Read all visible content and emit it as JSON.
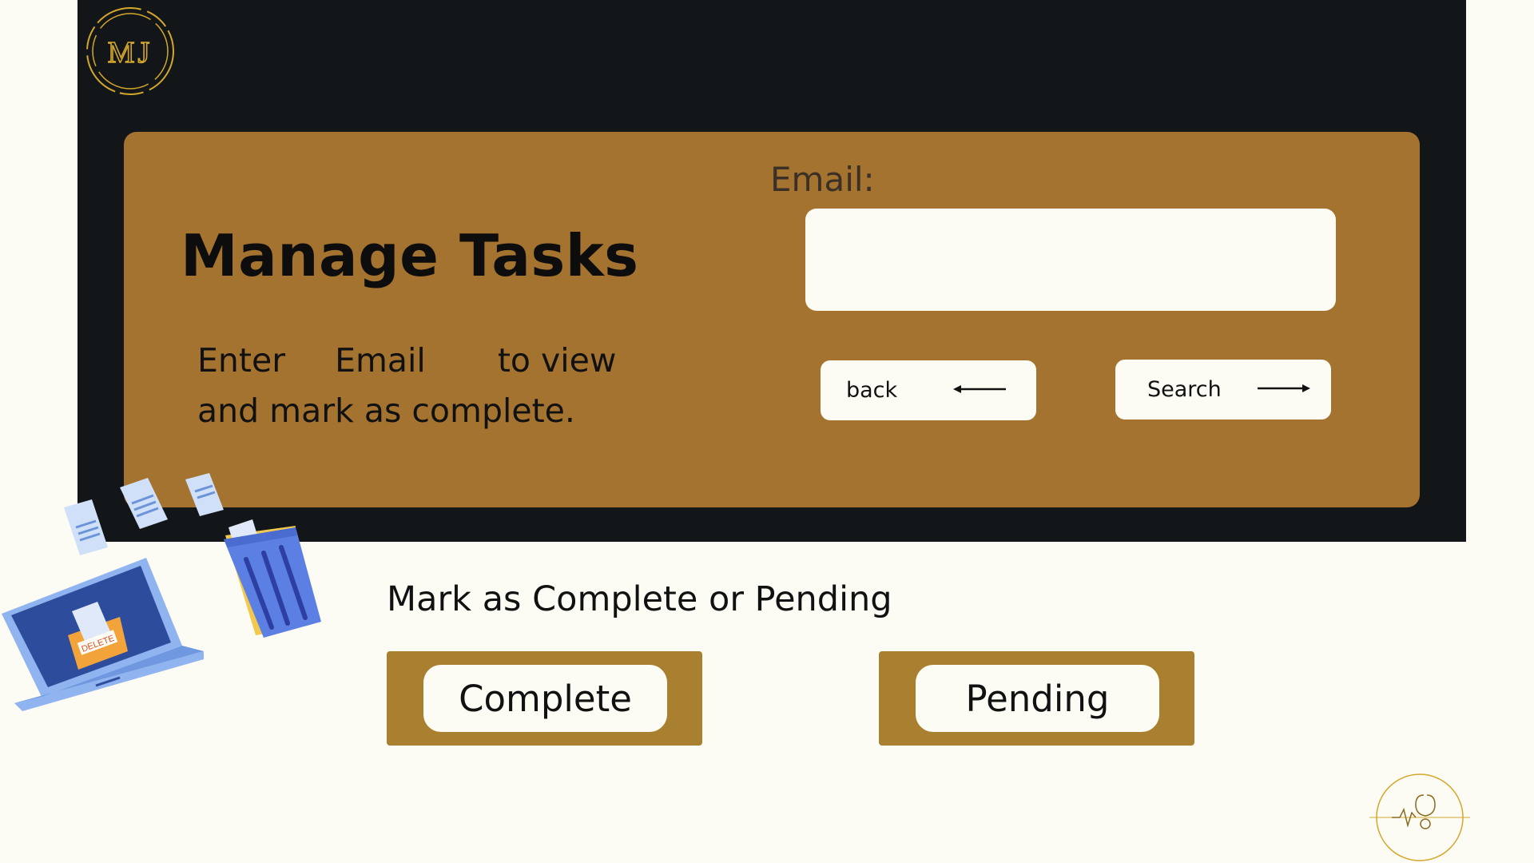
{
  "brand": {
    "logo_text": "MJ"
  },
  "card": {
    "title": "Manage Tasks",
    "description_word1": "Enter",
    "description_word2": "Email",
    "description_word3": "to view",
    "description_line2": "and mark as complete."
  },
  "email": {
    "label": "Email:",
    "value": "",
    "placeholder": ""
  },
  "buttons": {
    "back_label": "back",
    "search_label": "Search"
  },
  "status_section": {
    "heading": "Mark as Complete or Pending",
    "complete_label": "Complete",
    "pending_label": "Pending"
  },
  "illustration": {
    "tag_text": "DELETE"
  },
  "colors": {
    "page_bg": "#fdfcf4",
    "dark_panel": "#131619",
    "card_bg": "#a57330",
    "status_block": "#a8802f",
    "gold": "#d4a72c"
  },
  "icons": [
    "mj-logo-icon",
    "arrow-left-icon",
    "arrow-right-icon",
    "laptop-delete-illustration",
    "trash-bin-icon",
    "medical-badge-icon"
  ]
}
